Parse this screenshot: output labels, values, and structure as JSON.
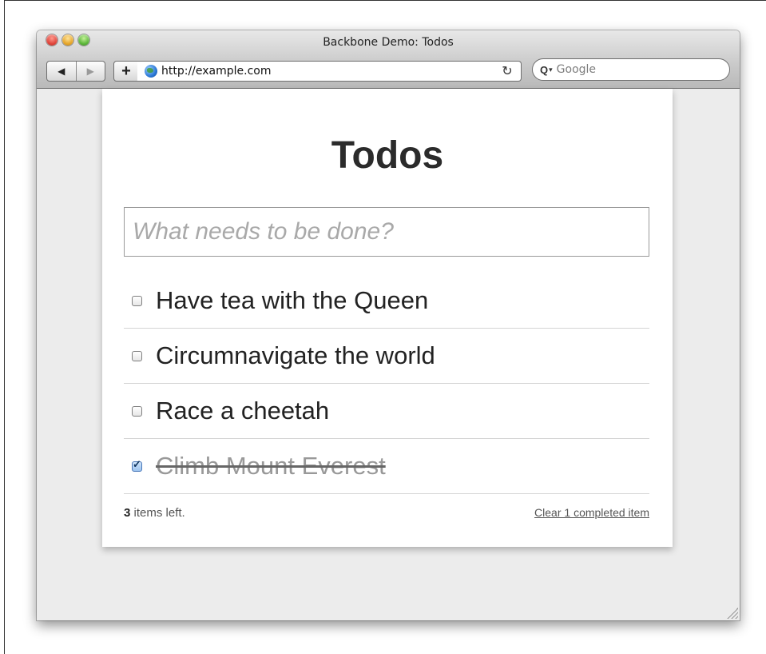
{
  "window": {
    "title": "Backbone Demo: Todos"
  },
  "toolbar": {
    "back_icon": "back-arrow-icon",
    "forward_icon": "forward-arrow-icon",
    "plus_label": "+",
    "url": "http://example.com",
    "reload_icon": "reload-icon",
    "search_placeholder": "Google"
  },
  "app": {
    "title": "Todos",
    "new_todo_placeholder": "What needs to be done?",
    "todos": [
      {
        "text": "Have tea with the Queen",
        "done": false
      },
      {
        "text": "Circumnavigate the world",
        "done": false
      },
      {
        "text": "Race a cheetah",
        "done": false
      },
      {
        "text": "Climb Mount Everest",
        "done": true
      }
    ],
    "footer": {
      "count": "3",
      "count_suffix": " items left.",
      "clear_label": "Clear 1 completed item"
    }
  },
  "colors": {
    "title_text": "#2b2b2b",
    "done_text": "#999999",
    "page_bg": "#ececec"
  }
}
